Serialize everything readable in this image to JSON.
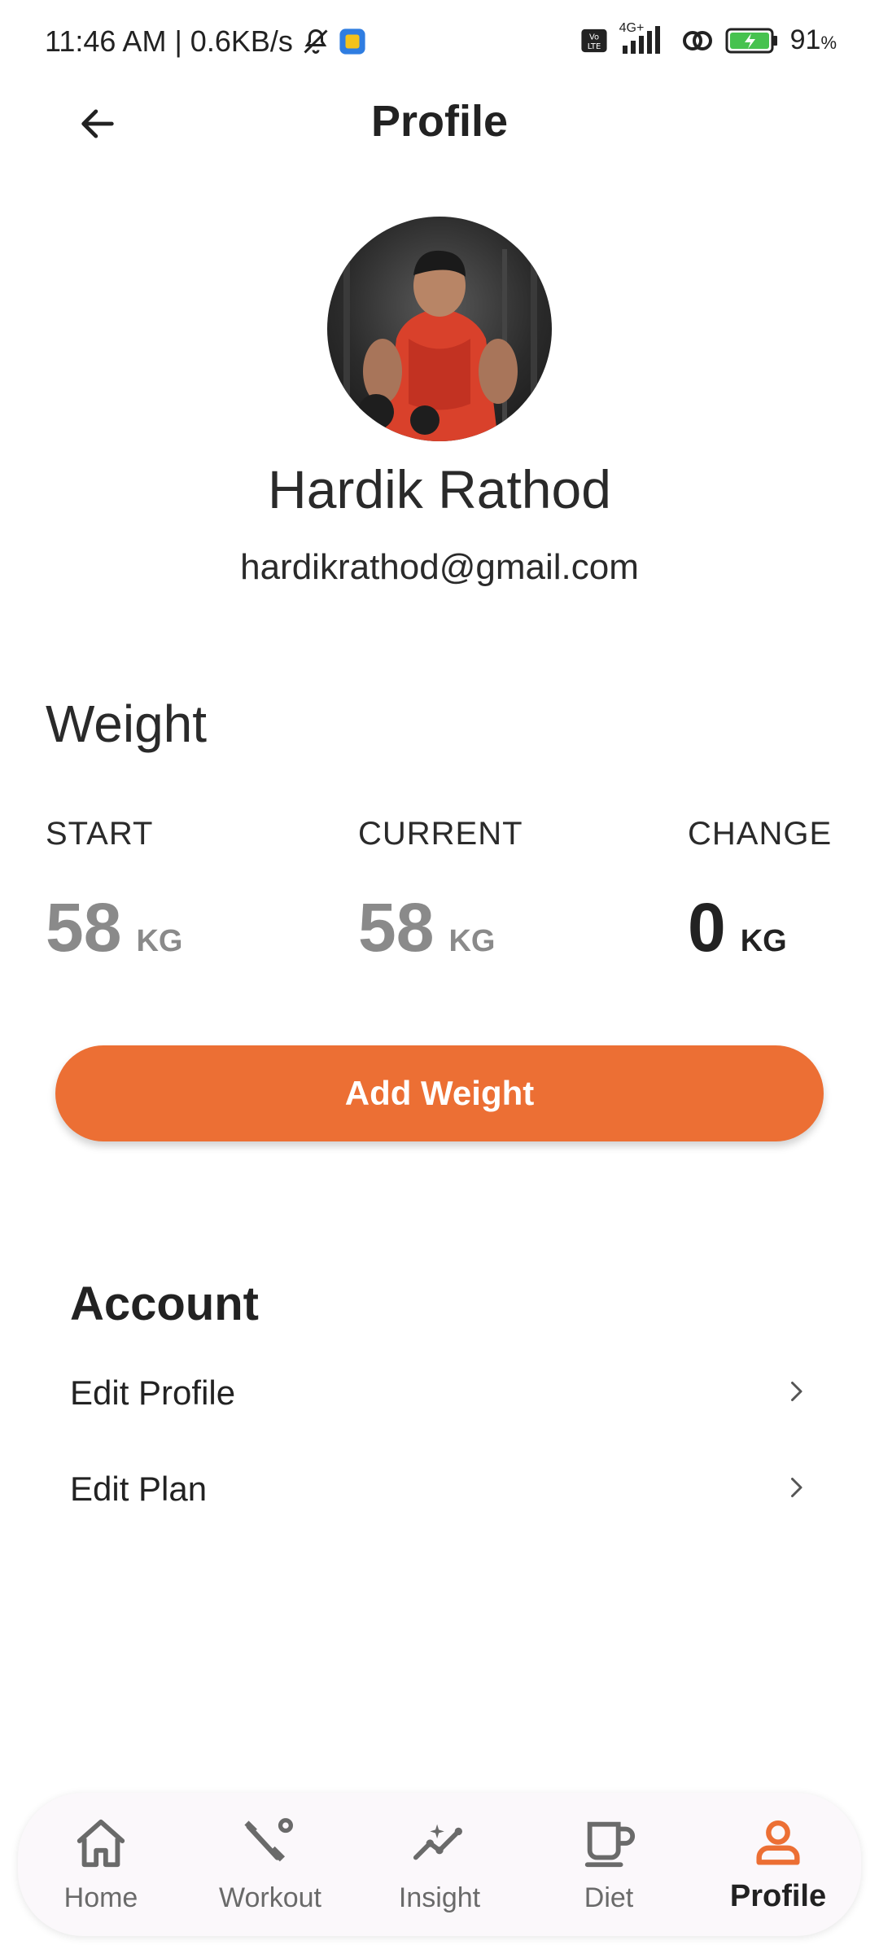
{
  "status_bar": {
    "time": "11:46 AM",
    "separator": "|",
    "network_speed": "0.6KB/s",
    "network_type": "4G+",
    "battery": "91",
    "battery_unit": "%"
  },
  "header": {
    "title": "Profile"
  },
  "profile": {
    "name": "Hardik Rathod",
    "email": "hardikrathod@gmail.com"
  },
  "weight": {
    "title": "Weight",
    "start": {
      "label": "START",
      "value": "58",
      "unit": "KG"
    },
    "current": {
      "label": "CURRENT",
      "value": "58",
      "unit": "KG"
    },
    "change": {
      "label": "CHANGE",
      "value": "0",
      "unit": "KG"
    },
    "add_button_label": "Add Weight"
  },
  "account": {
    "title": "Account",
    "items": [
      {
        "label": "Edit Profile"
      },
      {
        "label": "Edit Plan"
      }
    ]
  },
  "bottom_nav": {
    "items": [
      {
        "label": "Home",
        "icon": "home-icon"
      },
      {
        "label": "Workout",
        "icon": "workout-icon"
      },
      {
        "label": "Insight",
        "icon": "insight-icon"
      },
      {
        "label": "Diet",
        "icon": "diet-icon"
      },
      {
        "label": "Profile",
        "icon": "profile-icon"
      }
    ],
    "active": "Profile"
  },
  "colors": {
    "accent": "#ec6f34",
    "muted_value": "#8a8a8a",
    "text": "#222222",
    "nav_background": "#fbf8fb"
  }
}
